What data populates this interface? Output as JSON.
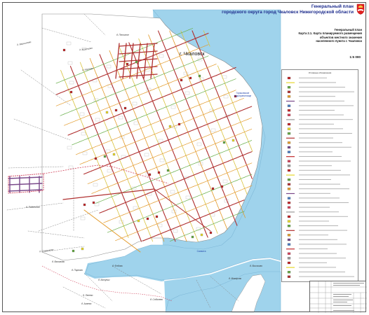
{
  "header": {
    "title_line1": "Генеральный план",
    "title_line2": "городского округа город Чкаловск Нижегородской области"
  },
  "map_title": {
    "line1": "Генеральный план",
    "line2": "Карта 2.1. Карта планируемого размещения",
    "line3": "объектов местного значения",
    "line4": "населенного пункта г. Чкаловск"
  },
  "scale": "1:5 000",
  "city_label": "г. Чкаловск",
  "reservoir_label": {
    "line1": "Горьковское",
    "line2": "водохранилище"
  },
  "river_label": "Санахта",
  "legend": {
    "title": "Условные обозначения"
  },
  "settlement_labels": [
    "д. Вершилово",
    "д. Кузнецово",
    "д. Песочное",
    "д. Карпово",
    "д. Подлесово",
    "д. Стариково",
    "д. Вахомово",
    "д. Федово",
    "д. Ленево",
    "д. Катунки",
    "д. Пархово",
    "д. Алаево",
    "д. Соболево",
    "д. Макарово",
    "д. Высоково"
  ],
  "colors": {
    "water": "#9fd3ec",
    "road_main": "#b03030",
    "road_secondary": "#e39b2c",
    "road_planned": "#d9c340",
    "road_minor": "#7a4a8a",
    "boundary": "#d1435b",
    "block": "#aaaaaa",
    "green_street": "#6ab04c",
    "title_text": "#1c2b8c"
  },
  "icons": [
    "coat-of-arms-icon"
  ]
}
